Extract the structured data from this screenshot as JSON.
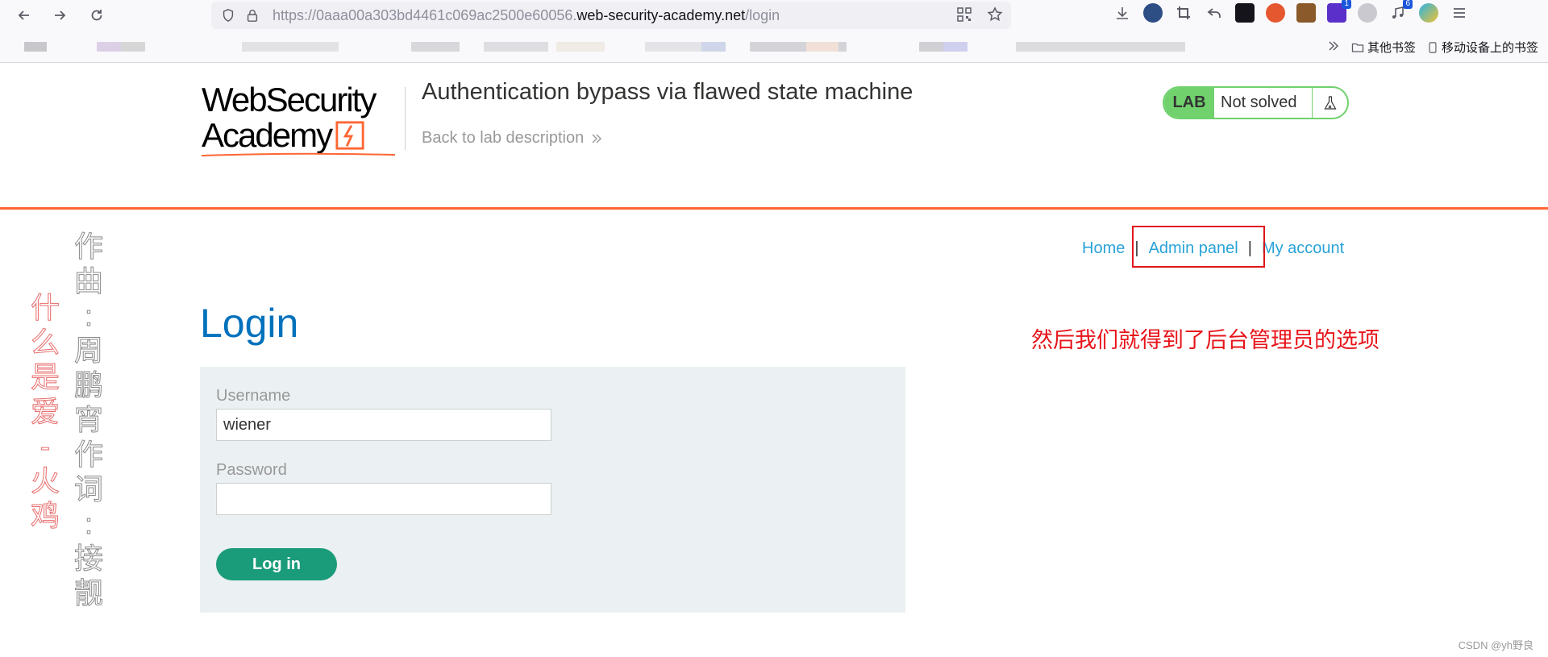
{
  "browser": {
    "url_prefix": "https://0aaa00a303bd4461c069ac2500e60056.",
    "url_domain": "web-security-academy.net",
    "url_path": "/login",
    "extension_badges": [
      "1",
      "6"
    ],
    "bookmarks": {
      "other": "其他书签",
      "mobile": "移动设备上的书签"
    }
  },
  "header": {
    "logo_line1": "WebSecurity",
    "logo_line2": "Academy",
    "lab_title": "Authentication bypass via flawed state machine",
    "back_link": "Back to lab description",
    "lab_badge": "LAB",
    "lab_state": "Not solved"
  },
  "nav": {
    "home": "Home",
    "separator": "|",
    "admin": "Admin panel",
    "account": "My account"
  },
  "annotation": "然后我们就得到了后台管理员的选项",
  "login": {
    "heading": "Login",
    "username_label": "Username",
    "username_value": "wiener",
    "password_label": "Password",
    "password_value": "",
    "submit": "Log in"
  },
  "lyrics": {
    "red": [
      "什",
      "么",
      "是",
      "爱",
      "-",
      "火",
      "鸡"
    ],
    "grey": [
      "作",
      "曲",
      ":",
      "周",
      "鹏",
      "宵",
      "作",
      "词",
      ":",
      "接",
      "靓"
    ]
  },
  "watermark": "CSDN @yh野良",
  "colors": {
    "accent_orange": "#ff6633",
    "link_blue": "#29a3d8",
    "heading_blue": "#0071bc",
    "lab_green": "#70d16d",
    "button_green": "#1a9c7b",
    "annotation_red": "#e8141a"
  }
}
